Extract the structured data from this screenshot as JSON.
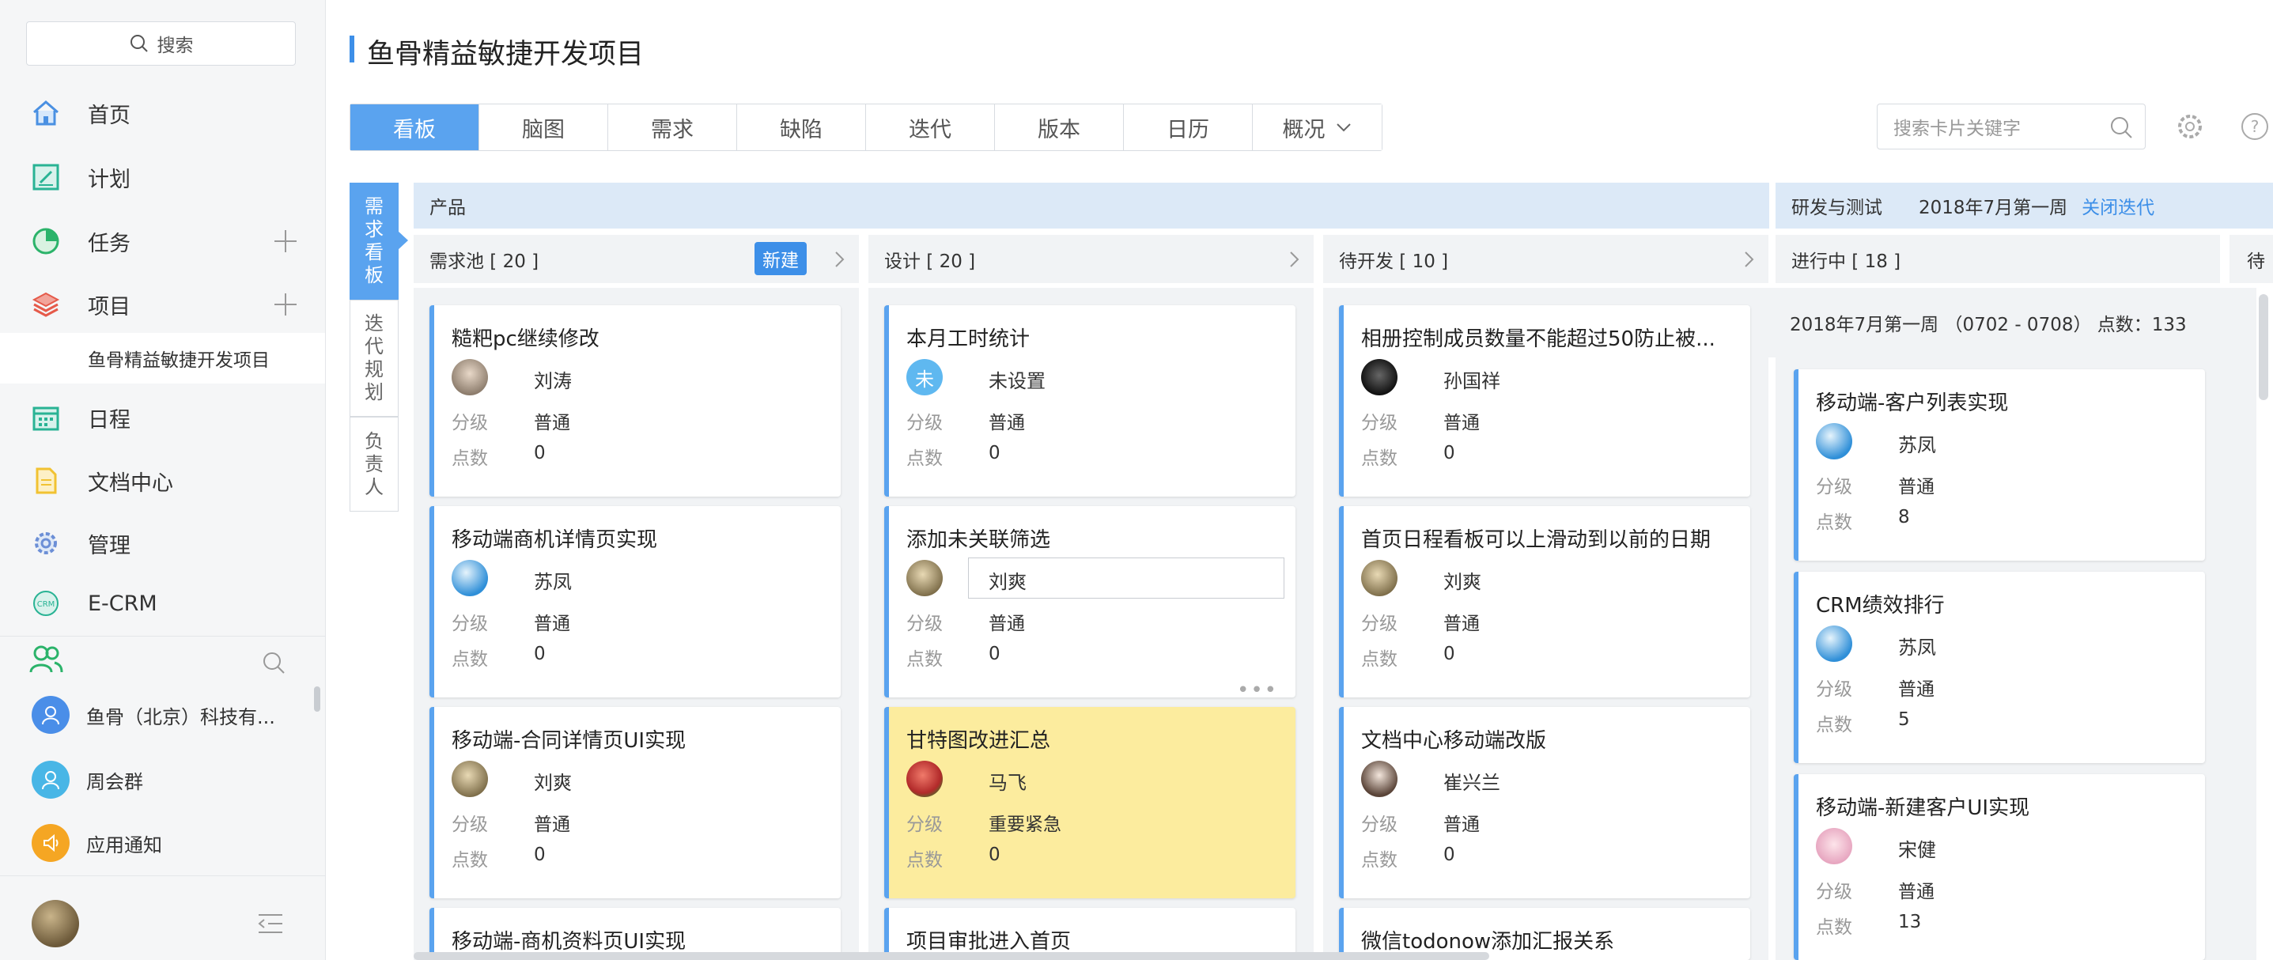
{
  "colors": {
    "accent": "#3d8fe8",
    "tab_active": "#5aa3ef",
    "group_header": "#dce9f7",
    "column_bg": "#f1f3f5",
    "highlight_card": "#fcec9e"
  },
  "sidebar": {
    "search_label": "搜索",
    "nav": [
      {
        "label": "首页",
        "icon": "home-icon"
      },
      {
        "label": "计划",
        "icon": "plan-icon"
      },
      {
        "label": "任务",
        "icon": "task-pie-icon",
        "addable": true
      },
      {
        "label": "项目",
        "icon": "project-layers-icon",
        "addable": true
      },
      {
        "label": "日程",
        "icon": "calendar-icon"
      },
      {
        "label": "文档中心",
        "icon": "document-icon"
      },
      {
        "label": "管理",
        "icon": "gear-icon"
      },
      {
        "label": "E-CRM",
        "icon": "crm-icon"
      }
    ],
    "active_project": "鱼骨精益敏捷开发项目",
    "contacts": [
      {
        "label": "鱼骨（北京）科技有...",
        "icon": "org-icon"
      },
      {
        "label": "周会群",
        "icon": "group-icon"
      },
      {
        "label": "应用通知",
        "icon": "notification-icon"
      }
    ]
  },
  "header": {
    "title": "鱼骨精益敏捷开发项目",
    "tabs": [
      "看板",
      "脑图",
      "需求",
      "缺陷",
      "迭代",
      "版本",
      "日历",
      "概况"
    ],
    "search_placeholder": "搜索卡片关键字"
  },
  "side_tabs": [
    "需求看板",
    "迭代规划",
    "负责人"
  ],
  "board": {
    "group_product": "产品",
    "group_dev": "研发与测试",
    "iteration_label": "2018年7月第一周",
    "close_iteration": "关闭迭代",
    "new_button": "新建",
    "iteration_summary": "2018年7月第一周 （0702 - 0708） 点数：133",
    "next_column_partial": "待",
    "level_label": "分级",
    "points_label": "点数",
    "columns": [
      {
        "title": "需求池 [ 20 ]",
        "cards": [
          {
            "title": "糙粑pc继续修改",
            "owner": "刘涛",
            "level": "普通",
            "points": "0"
          },
          {
            "title": "移动端商机详情页实现",
            "owner": "苏凤",
            "level": "普通",
            "points": "0"
          },
          {
            "title": "移动端-合同详情页UI实现",
            "owner": "刘爽",
            "level": "普通",
            "points": "0"
          },
          {
            "title": "移动端-商机资料页UI实现"
          }
        ]
      },
      {
        "title": "设计 [ 20 ]",
        "cards": [
          {
            "title": "本月工时统计",
            "owner": "未设置",
            "avatar_text": "未",
            "level": "普通",
            "points": "0"
          },
          {
            "title": "添加未关联筛选",
            "owner": "刘爽",
            "level": "普通",
            "points": "0"
          },
          {
            "title": "甘特图改进汇总",
            "owner": "马飞",
            "level": "重要紧急",
            "points": "0"
          },
          {
            "title": "项目审批进入首页"
          }
        ]
      },
      {
        "title": "待开发 [ 10 ]",
        "cards": [
          {
            "title": "相册控制成员数量不能超过50防止被...",
            "owner": "孙国祥",
            "level": "普通",
            "points": "0"
          },
          {
            "title": "首页日程看板可以上滑动到以前的日期",
            "owner": "刘爽",
            "level": "普通",
            "points": "0"
          },
          {
            "title": "文档中心移动端改版",
            "owner": "崔兴兰",
            "level": "普通",
            "points": "0"
          },
          {
            "title": "微信todonow添加汇报关系"
          }
        ]
      },
      {
        "title": "进行中 [ 18 ]",
        "cards": [
          {
            "title": "移动端-客户列表实现",
            "owner": "苏凤",
            "level": "普通",
            "points": "8"
          },
          {
            "title": "CRM绩效排行",
            "owner": "苏凤",
            "level": "普通",
            "points": "5"
          },
          {
            "title": "移动端-新建客户UI实现",
            "owner": "宋健",
            "level": "普通",
            "points": "13"
          }
        ]
      }
    ]
  }
}
